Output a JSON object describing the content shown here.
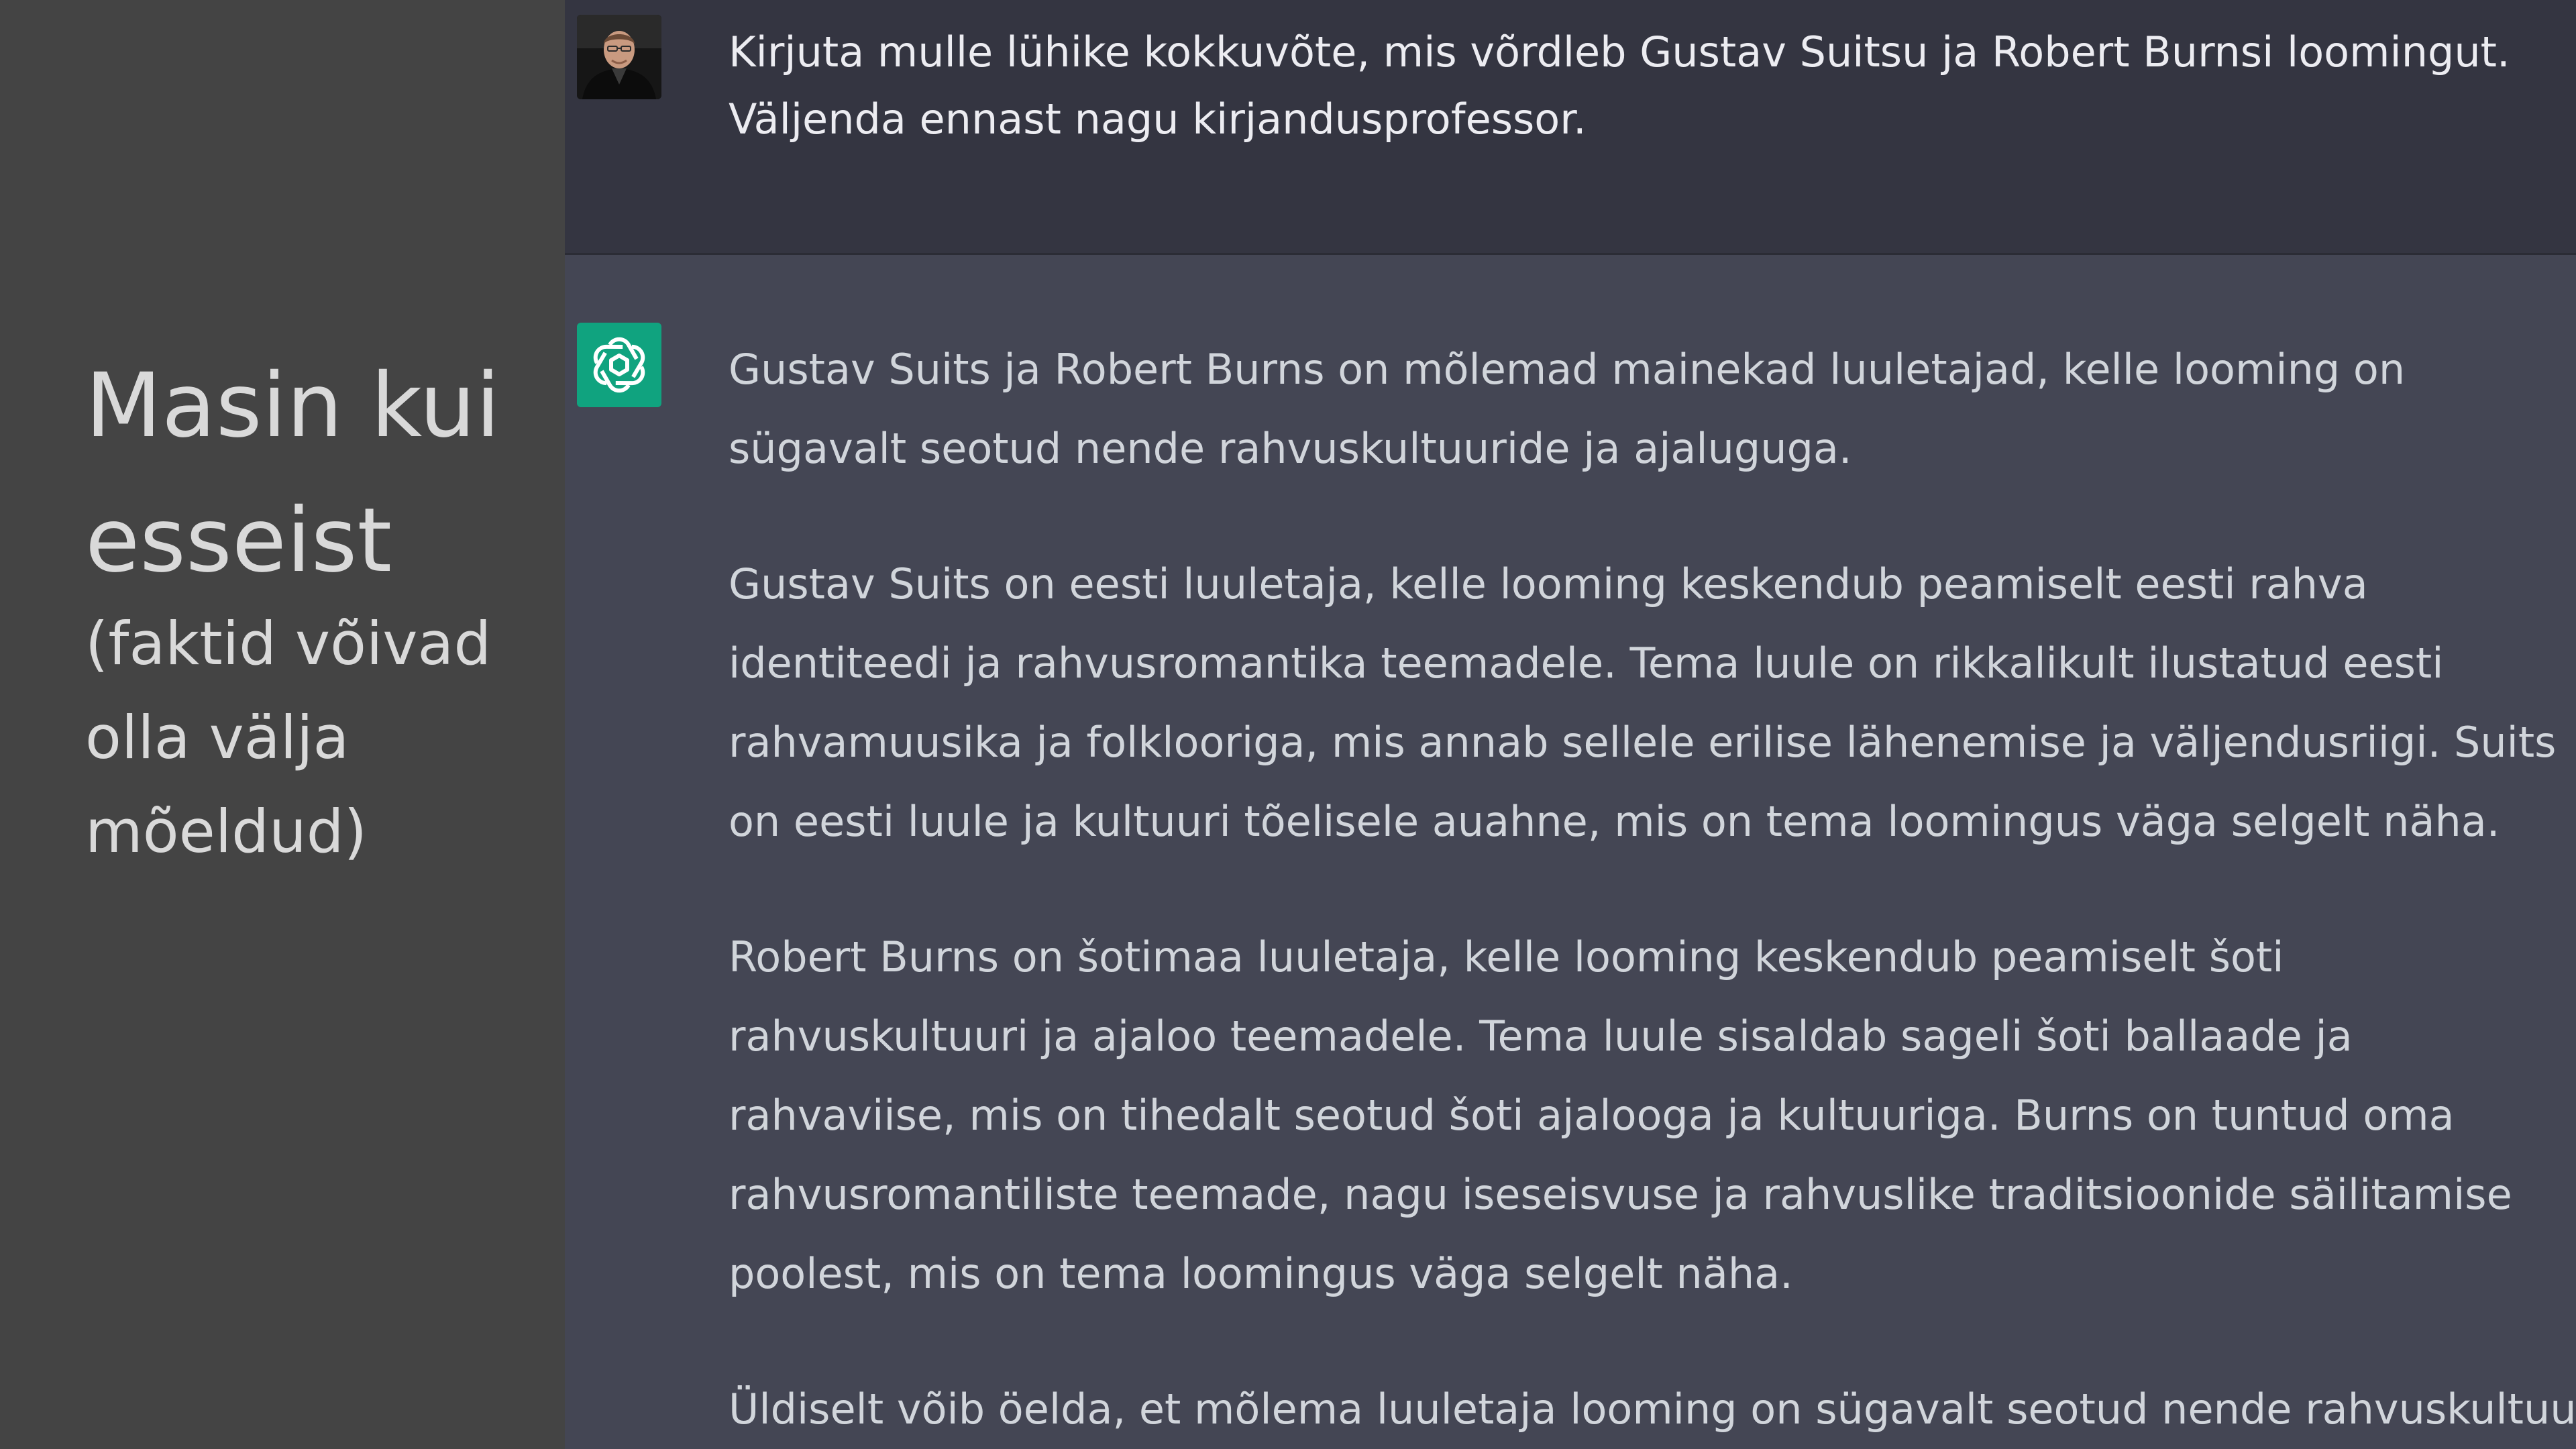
{
  "slide": {
    "title": "Masin kui esseist",
    "subtitle": "(faktid võivad olla välja mõeldud)"
  },
  "chat": {
    "user_message": "Kirjuta mulle lühike kokkuvõte, mis võrdleb Gustav Suitsu ja Robert Burnsi loomingut. Väljenda ennast nagu kirjandusprofessor.",
    "assistant_paragraphs": [
      "Gustav Suits ja Robert Burns on mõlemad mainekad luuletajad, kelle looming on sügavalt seotud nende rahvuskultuuride ja ajaluguga.",
      "Gustav Suits on eesti luuletaja, kelle looming keskendub peamiselt eesti rahva identiteedi ja rahvusromantika teemadele. Tema luule on rikkalikult ilustatud eesti rahvamuusika ja folklooriga, mis annab sellele erilise lähenemise ja väljendusriigi. Suits on eesti luule ja kultuuri tõelisele auahne, mis on tema loomingus väga selgelt näha.",
      "Robert Burns on šotimaa luuletaja, kelle looming keskendub peamiselt šoti rahvuskultuuri ja ajaloo teemadele. Tema luule sisaldab sageli šoti ballaade ja rahvaviise, mis on tihedalt seotud šoti ajalooga ja kultuuriga. Burns on tuntud oma rahvusromantiliste teemade, nagu iseseisvuse ja rahvuslike traditsioonide säilitamise poolest, mis on tema loomingus väga selgelt näha.",
      "Üldiselt võib öelda, et mõlema luuletaja looming on sügavalt seotud nende rahvuskultuuride"
    ]
  },
  "icons": {
    "user_avatar": "user-avatar-photo",
    "assistant_avatar": "openai-logo-icon"
  },
  "colors": {
    "left_panel": "#444444",
    "user_row": "#343541",
    "assistant_row": "#444654",
    "assistant_logo_bg": "#10a37f",
    "user_text": "#ececf1",
    "assistant_text": "#d1d5db"
  }
}
